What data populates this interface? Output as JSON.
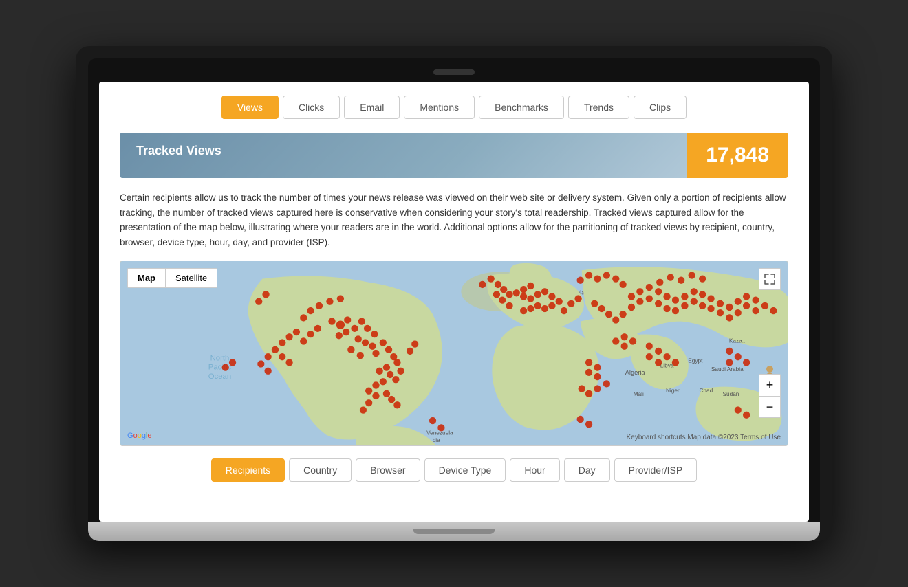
{
  "nav": {
    "tabs": [
      {
        "id": "views",
        "label": "Views",
        "active": true
      },
      {
        "id": "clicks",
        "label": "Clicks",
        "active": false
      },
      {
        "id": "email",
        "label": "Email",
        "active": false
      },
      {
        "id": "mentions",
        "label": "Mentions",
        "active": false
      },
      {
        "id": "benchmarks",
        "label": "Benchmarks",
        "active": false
      },
      {
        "id": "trends",
        "label": "Trends",
        "active": false
      },
      {
        "id": "clips",
        "label": "Clips",
        "active": false
      }
    ]
  },
  "tracked_views": {
    "label": "Tracked Views",
    "count": "17,848"
  },
  "description": {
    "text": "Certain recipients allow us to track the number of times your news release was viewed on their web site or delivery system. Given only a portion of recipients allow tracking, the number of tracked views captured here is conservative when considering your story's total readership. Tracked views captured allow for the presentation of the map below, illustrating where your readers are in the world. Additional options allow for the partitioning of tracked views by recipient, country, browser, device type, hour, day, and provider (ISP)."
  },
  "map": {
    "type_buttons": [
      {
        "label": "Map",
        "active": true
      },
      {
        "label": "Satellite",
        "active": false
      }
    ],
    "expand_icon": "⤢",
    "person_icon": "🧍",
    "zoom_plus": "+",
    "zoom_minus": "−",
    "google_label": "Google",
    "attribution": "Keyboard shortcuts  Map data ©2023  Terms of Use"
  },
  "filter_tabs": {
    "tabs": [
      {
        "id": "recipients",
        "label": "Recipients",
        "active": true
      },
      {
        "id": "country",
        "label": "Country",
        "active": false
      },
      {
        "id": "browser",
        "label": "Browser",
        "active": false
      },
      {
        "id": "device_type",
        "label": "Device Type",
        "active": false
      },
      {
        "id": "hour",
        "label": "Hour",
        "active": false
      },
      {
        "id": "day",
        "label": "Day",
        "active": false
      },
      {
        "id": "provider_isp",
        "label": "Provider/ISP",
        "active": false
      }
    ]
  },
  "colors": {
    "active_tab": "#f5a623",
    "tracked_views_bg": "#7a9db5",
    "count_bg": "#f5a623",
    "marker_color": "#cc2200"
  }
}
